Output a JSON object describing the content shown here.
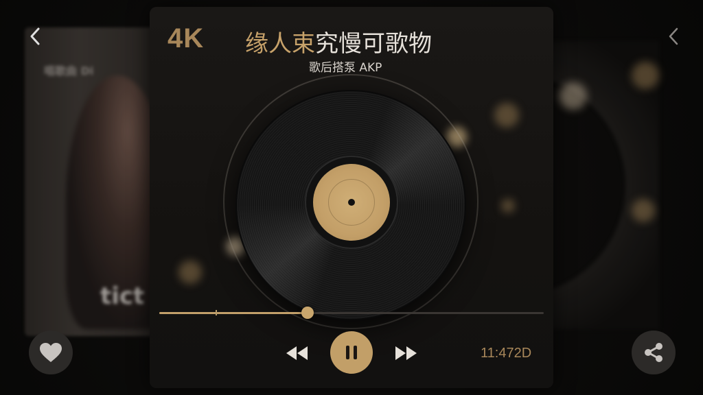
{
  "header": {
    "quality_badge": "4K",
    "title_gold": "缘人束",
    "title_rest": "究慢可歌物",
    "subtitle": "歌后搭泵 AKP"
  },
  "left_card": {
    "top_text": "唱歌曲 Di",
    "bottom_text": "tict"
  },
  "player": {
    "progress": 0.385,
    "time_text": "11:472D"
  },
  "icons": {
    "back_left": "chevron-left-icon",
    "back_right": "chevron-left-icon",
    "prev": "rewind-icon",
    "play_pause": "pause-icon",
    "next": "fast-forward-icon",
    "heart": "heart-icon",
    "share": "share-icon"
  },
  "colors": {
    "accent_gold": "#c29f68",
    "title_white": "#e6e1da",
    "background": "#0a0908"
  }
}
